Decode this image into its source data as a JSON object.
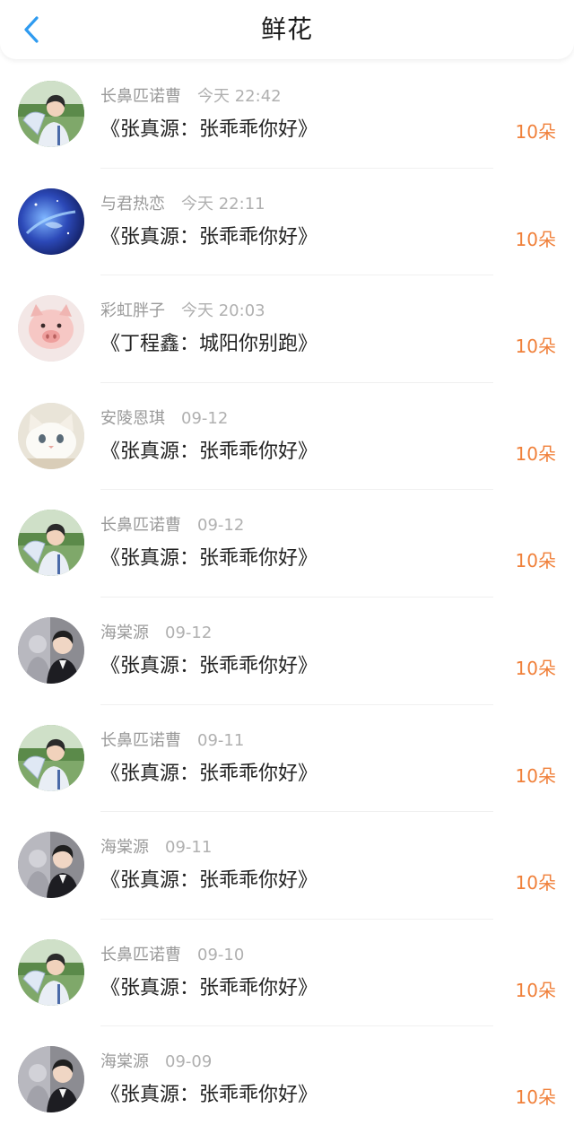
{
  "header": {
    "title": "鲜花",
    "back_icon": "chevron-left-icon",
    "accent_color": "#2f9bf0"
  },
  "items": [
    {
      "user": "长鼻匹诺曹",
      "time": "今天 22:42",
      "gift": "《张真源：张乖乖你好》",
      "count": "10朵",
      "avatar": "boy-with-fan-avatar"
    },
    {
      "user": "与君热恋",
      "time": "今天 22:11",
      "gift": "《张真源：张乖乖你好》",
      "count": "10朵",
      "avatar": "blue-galaxy-avatar"
    },
    {
      "user": "彩虹胖子",
      "time": "今天 20:03",
      "gift": "《丁程鑫：城阳你别跑》",
      "count": "10朵",
      "avatar": "pink-pig-avatar"
    },
    {
      "user": "安陵恩琪",
      "time": "09-12",
      "gift": "《张真源：张乖乖你好》",
      "count": "10朵",
      "avatar": "white-cat-avatar"
    },
    {
      "user": "长鼻匹诺曹",
      "time": "09-12",
      "gift": "《张真源：张乖乖你好》",
      "count": "10朵",
      "avatar": "boy-with-fan-avatar"
    },
    {
      "user": "海棠源",
      "time": "09-12",
      "gift": "《张真源：张乖乖你好》",
      "count": "10朵",
      "avatar": "boy-in-suit-avatar"
    },
    {
      "user": "长鼻匹诺曹",
      "time": "09-11",
      "gift": "《张真源：张乖乖你好》",
      "count": "10朵",
      "avatar": "boy-with-fan-avatar"
    },
    {
      "user": "海棠源",
      "time": "09-11",
      "gift": "《张真源：张乖乖你好》",
      "count": "10朵",
      "avatar": "boy-in-suit-avatar"
    },
    {
      "user": "长鼻匹诺曹",
      "time": "09-10",
      "gift": "《张真源：张乖乖你好》",
      "count": "10朵",
      "avatar": "boy-with-fan-avatar"
    },
    {
      "user": "海棠源",
      "time": "09-09",
      "gift": "《张真源：张乖乖你好》",
      "count": "10朵",
      "avatar": "boy-in-suit-avatar"
    }
  ],
  "colors": {
    "username": "#9a9a9a",
    "time": "#b0b0b0",
    "gift_text": "#222222",
    "count": "#f0803a"
  }
}
